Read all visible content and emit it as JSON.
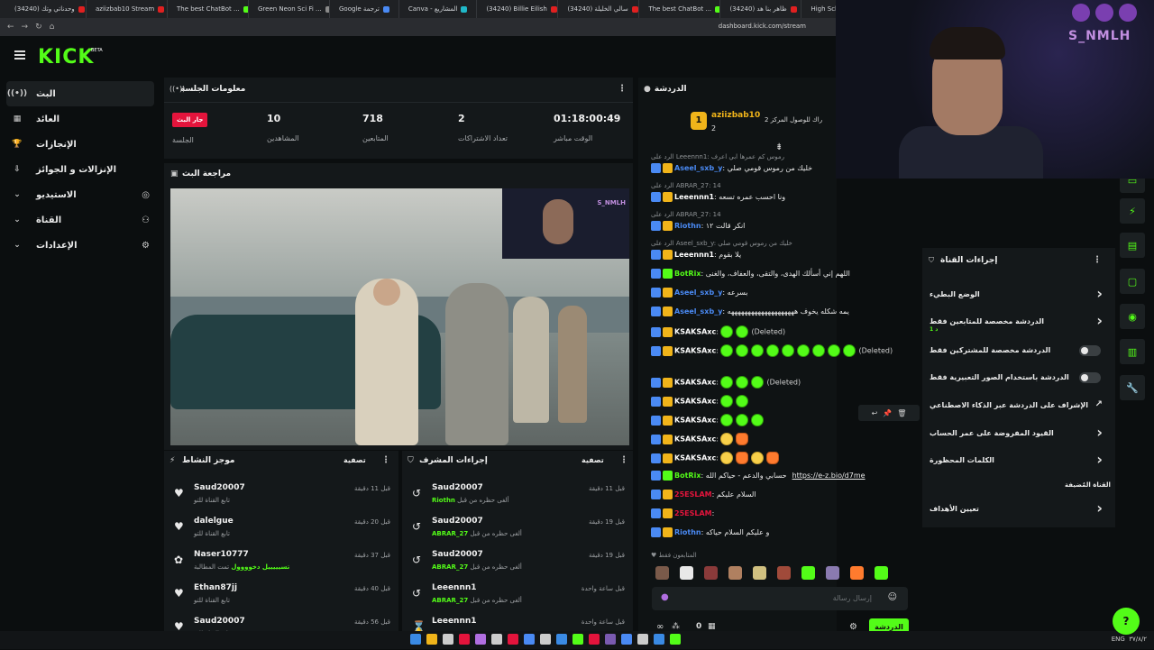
{
  "browser": {
    "tabs": [
      {
        "label": "وحدناتي وتك (34240)",
        "color": "#e02020"
      },
      {
        "label": "aziizbab10 Stream",
        "color": "#e02020"
      },
      {
        "label": "The best ChatBot ...",
        "color": "#53fc18"
      },
      {
        "label": "Green Neon Sci Fi ...",
        "color": "#8a8a8a"
      },
      {
        "label": "Google ترجمة",
        "color": "#4a8af4"
      },
      {
        "label": "Canva - المشاريع",
        "color": "#20b8c8"
      },
      {
        "label": "(34240) Billie Eilish",
        "color": "#e02020"
      },
      {
        "label": "(34240) سالي الخليلة",
        "color": "#e02020"
      },
      {
        "label": "The best ChatBot ...",
        "color": "#53fc18"
      },
      {
        "label": "(34240) ظاهر بنا هد",
        "color": "#e02020"
      },
      {
        "label": "High Scho...",
        "color": "#e02020"
      }
    ],
    "url": "dashboard.kick.com/stream"
  },
  "brand": {
    "logo": "KICK",
    "beta": "BETA",
    "accent": "#53fc18"
  },
  "sidebar": {
    "items": [
      {
        "label": "البث",
        "icon": "live-icon",
        "active": true
      },
      {
        "label": "العائد",
        "icon": "chart-icon"
      },
      {
        "label": "الإنجازات",
        "icon": "trophy-icon"
      },
      {
        "label": "الإنزالات و الجوائز",
        "icon": "drops-icon"
      },
      {
        "label": "الاستيديو",
        "icon": "studio-icon",
        "expand": true
      },
      {
        "label": "القناة",
        "icon": "channel-icon",
        "expand": true
      },
      {
        "label": "الإعدادات",
        "icon": "gear-icon",
        "expand": true
      }
    ]
  },
  "session": {
    "title": "معلومات الجلسة",
    "live_badge": "جار البث",
    "session_label": "الجلسة",
    "stats": [
      {
        "value": "10",
        "label": "المشاهدين"
      },
      {
        "value": "718",
        "label": "المتابعين"
      },
      {
        "value": "2",
        "label": "تعداد الاشتراكات"
      },
      {
        "value": "01:18:00:49",
        "label": "الوقت مباشر"
      }
    ]
  },
  "preview": {
    "title": "مراجعة البث",
    "cam_brand": "S_NMLH"
  },
  "activity": {
    "title": "موجز النشاط",
    "filter": "تصفية",
    "rows": [
      {
        "user": "Saud20007",
        "sub": "تابع القناة للتو",
        "time": "قبل 11 دقيقة",
        "icon": "heart-icon"
      },
      {
        "user": "dalelgue",
        "sub": "تابع القناة للتو",
        "time": "قبل 20 دقيقة",
        "icon": "heart-icon"
      },
      {
        "user": "Naser10777",
        "sub_prefix": "تمت المطالبة",
        "sub_highlight": "تسيييييل دخوووول",
        "time": "قبل 37 دقيقة",
        "icon": "reward-icon"
      },
      {
        "user": "Ethan87jj",
        "sub": "تابع القناة للتو",
        "time": "قبل 40 دقيقة",
        "icon": "heart-icon"
      },
      {
        "user": "Saud20007",
        "sub": "تابع القناة للتو",
        "time": "قبل 56 دقيقة",
        "icon": "heart-icon"
      }
    ]
  },
  "modactions": {
    "title": "إجراءات المشرف",
    "filter": "تصفية",
    "rows": [
      {
        "user": "Saud20007",
        "sub_prefix": "ألغى حظره من قبل",
        "by": "Riothn",
        "time": "قبل 11 دقيقة"
      },
      {
        "user": "Saud20007",
        "sub_prefix": "ألغى حظره من قبل",
        "by": "ABRAR_27",
        "time": "قبل 19 دقيقة"
      },
      {
        "user": "Saud20007",
        "sub_prefix": "ألغى حظره من قبل",
        "by": "ABRAR_27",
        "time": "قبل 19 دقيقة"
      },
      {
        "user": "Leeennn1",
        "sub_prefix": "ألغى حظره من قبل",
        "by": "ABRAR_27",
        "time": "قبل ساعة واحدة"
      },
      {
        "user": "Leeennn1",
        "sub_prefix": "",
        "by": "",
        "time": "قبل ساعة واحدة"
      }
    ]
  },
  "chat": {
    "title": "الدردشة",
    "pinned": {
      "rank": "1",
      "user": "aziizbab10",
      "count": "2",
      "note": "راك للوصول المركز 2"
    },
    "messages": [
      {
        "reply": "الرد على Leeennn1: رموس كم عمرها ابي اعرف",
        "user": "Aseel_sxb_y",
        "color": "#4a8af4",
        "text": "خليك من رموس قومي صلي"
      },
      {
        "reply": "الرد على ABRAR_27: 14",
        "user": "Leeennn1",
        "color": "#ffffff",
        "text": "ونا احسب عمره تسعه"
      },
      {
        "reply": "الرد على ABRAR_27: 14",
        "user": "Riothn",
        "color": "#4a8af4",
        "text": "انكر قالت ١٢"
      },
      {
        "reply": "الرد على Aseel_sxb_y: خليك من رموس قومي صلي",
        "user": "Leeennn1",
        "color": "#ffffff",
        "text": "يلا بقوم"
      },
      {
        "user": "BotRix",
        "color": "#53fc18",
        "text": "اللهم إني أسألك الهدى، والتقى، والعفاف، والغنى"
      },
      {
        "user": "Aseel_sxb_y",
        "color": "#4a8af4",
        "text": "بسرعه"
      },
      {
        "user": "Aseel_sxb_y",
        "color": "#4a8af4",
        "text": "يمه شكله يخوف ههههههههههههههههههههه"
      },
      {
        "user": "KSAKSAxc",
        "color": "#ffffff",
        "text": "(Deleted)",
        "emotes": 2
      },
      {
        "user": "KSAKSAxc",
        "color": "#ffffff",
        "text": "(Deleted)",
        "emotes": 9
      },
      {
        "user": "KSAKSAxc",
        "color": "#ffffff",
        "text": "(Deleted)",
        "emotes": 3
      },
      {
        "user": "KSAKSAxc",
        "color": "#ffffff",
        "text": "",
        "emotes": 2
      },
      {
        "user": "KSAKSAxc",
        "color": "#ffffff",
        "text": "",
        "emotes": 3
      },
      {
        "user": "KSAKSAxc",
        "color": "#ffffff",
        "text": "",
        "emotes": 2
      },
      {
        "user": "KSAKSAxc",
        "color": "#ffffff",
        "text": "",
        "emotes": 4
      },
      {
        "user": "BotRix",
        "color": "#53fc18",
        "text": "حسابي والدعم - حياكم الله",
        "link": "https://e-z.bio/d7me"
      },
      {
        "user": "25ESLAM",
        "color": "#e4143c",
        "text": "السلام عليكم"
      },
      {
        "user": "25ESLAM",
        "color": "#e4143c",
        "text": ""
      },
      {
        "user": "Riothn",
        "color": "#4a8af4",
        "text": "و عليكم السلام حياكه"
      }
    ],
    "followers_only": "المتابعون فقط",
    "input_placeholder": "إرسال رسالة",
    "send_label": "الدردشة",
    "viewer_count": "0"
  },
  "channel_actions": {
    "title": "إجراءات القناة",
    "items": [
      {
        "label": "الوضع البطيء",
        "control": "chevron"
      },
      {
        "label": "الدردشة مخصصة للمتابعين فقط",
        "sub": "1 د",
        "control": "chevron"
      },
      {
        "label": "الدردشة مخصصة للمشتركين فقط",
        "control": "toggle"
      },
      {
        "label": "الدردشة باستخدام الصور التعبيرية فقط",
        "control": "toggle"
      },
      {
        "label": "الإشراف على الدردشة عبر الذكاء الاصطناعي",
        "control": "external"
      },
      {
        "label": "القيود المفروضة على عمر الحساب",
        "control": "chevron"
      },
      {
        "label": "الكلمات المحظورة",
        "control": "chevron"
      },
      {
        "label": "القناة المُضيفة",
        "control": "none"
      },
      {
        "label": "تعيين الأهداف",
        "control": "chevron"
      }
    ]
  },
  "overlay": {
    "brand": "S_NMLH"
  },
  "taskbar": {
    "lang": "ENG",
    "time": "۳۷/۸/۲"
  },
  "help_label": "?"
}
